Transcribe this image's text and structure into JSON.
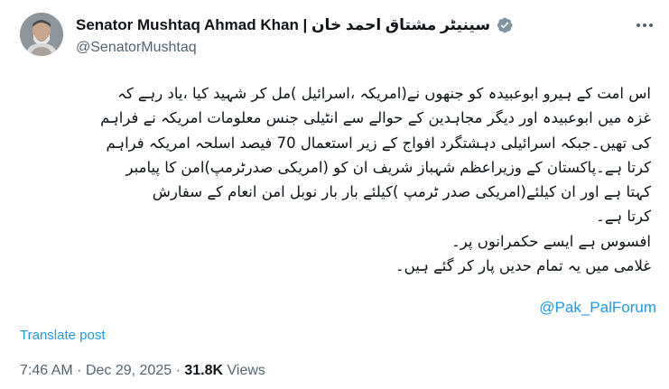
{
  "author": {
    "name": "Senator Mushtaq Ahmad Khan | سینیٹر مشتاق احمد خان",
    "handle": "@SenatorMushtaq"
  },
  "post": {
    "lines": [
      "اس امت کے ہیرو ابوعبیدہ کو جنھوں نے(امریکہ ،اسرائیل )مل کر شہید کیا ،یاد رہے کہ",
      "غزہ میں ابوعبیدہ اور دیگر مجاہدین کے حوالے سے انٹیلی جنس معلومات امریکہ نے فراہم",
      "کی تھیں۔جبکہ اسرائیلی دہشتگرد افواج کے زیر استعمال 70 فیصد اسلحہ امریکہ فراہم",
      "کرتا ہے۔پاکستان کے وزیراعظم شہباز شریف ان کو (امریکی صدرٹرمپ)امن کا پیامبر",
      "کہتا ہے اور ان کیلئے(امریکی صدر ٹرمپ )کیلئے بار بار  نوبل امن انعام کے سفارش",
      "کرتا ہے۔",
      "افسوس ہے ایسے حکمرانوں پر۔",
      "غلامی میں یہ تمام حدیں  پار کر گئے ہیں۔"
    ],
    "mention": "@Pak_PalForum"
  },
  "translate_label": "Translate post",
  "meta": {
    "time": "7:46 AM",
    "separator": "·",
    "date": "Dec 29, 2025",
    "views_count": "31.8K",
    "views_label": "Views"
  }
}
